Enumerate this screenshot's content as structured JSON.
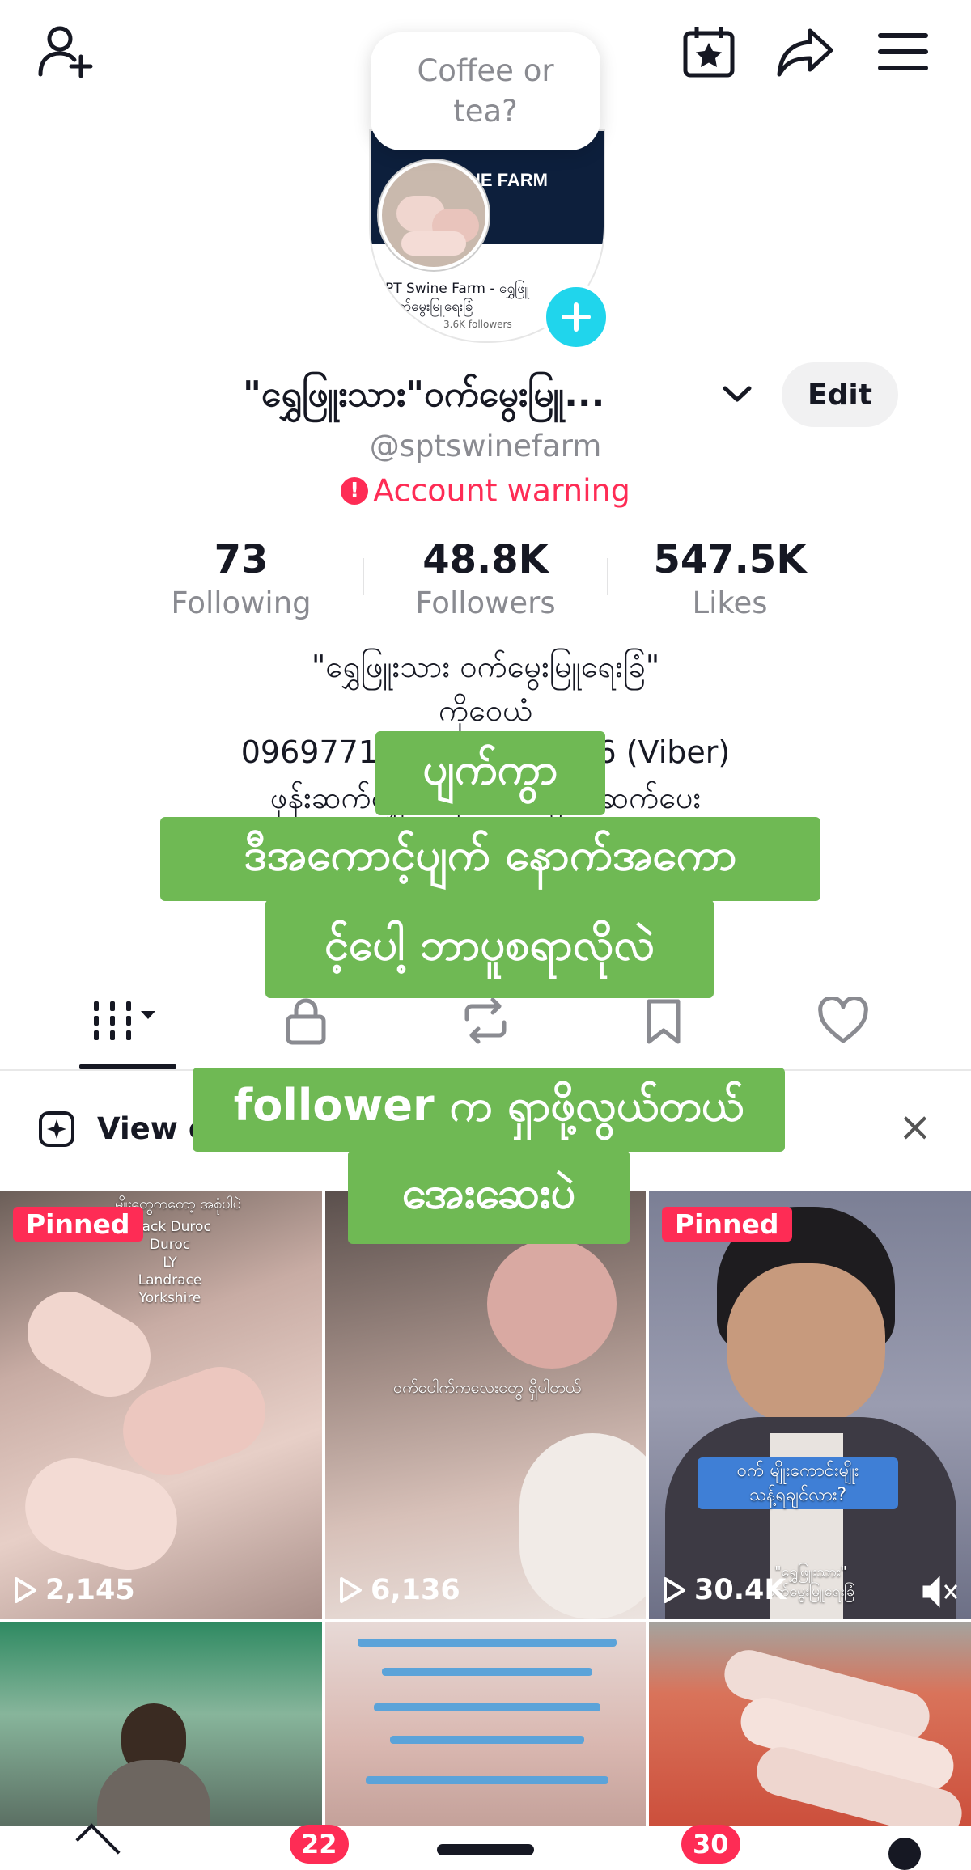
{
  "header": {
    "add_friend_icon": "person-plus-icon",
    "calendar_icon": "calendar-star-icon",
    "share_icon": "share-arrow-icon",
    "menu_icon": "hamburger-menu-icon",
    "tooltip": "Coffee or\ntea?"
  },
  "avatar": {
    "banner_text": "NE FARM",
    "card_name": "PT Swine Farm - ရွှေဖြူ",
    "card_sub": "ဝက်မွေးမြူရေးခြံ",
    "card_followers": "3.6K followers"
  },
  "profile": {
    "name": "\"ရွှေဖြူးသား\"ဝက်မွေးမြူ...",
    "edit_label": "Edit",
    "handle": "@sptswinefarm",
    "warning": "Account warning"
  },
  "stats": [
    {
      "value": "73",
      "label": "Following"
    },
    {
      "value": "48.8K",
      "label": "Followers"
    },
    {
      "value": "547.5K",
      "label": "Likes"
    }
  ],
  "bio": {
    "line1": "\"ရွှေဖြူးသား ဝက်မွေးမြူရေးခြံ\"",
    "line2": "ကိုဝေယံ",
    "line3": "09697714433(V          704916 (Viber)",
    "line4": "ဖုန်းဆက်လျှင် မနက်                    အတွင်း  ဆက်ပေး"
  },
  "captions": {
    "c1": "ပျက်ကွာ",
    "c2": "ဒီအကောင့်ပျက် နောက်အကော",
    "c3": "င့်ပေါ့ ဘာပူစရာလိုလဲ",
    "c4": "follower က ရှာဖို့လွယ်တယ်",
    "c5": "အေးဆေးပဲ"
  },
  "banner": {
    "label": "View e",
    "close": "×"
  },
  "videos": [
    {
      "pinned": "Pinned",
      "views": "2,145",
      "text": "Black Duroc\nDuroc\nLY\nLandrace\nYorkshire",
      "top_text": "မျိုးတွေကတော့ အစုံပါပဲ"
    },
    {
      "pinned": "",
      "views": "6,136",
      "text": "ဝက်ပေါက်ကလေးတွေ ရှိပါတယ်"
    },
    {
      "pinned": "Pinned",
      "views": "30.4K",
      "text": "ဝက် မျိုးကောင်းမျိုး\nသန့်ရချင်လား?",
      "bottom_text": "\"ရွှေဖြူးသား\"\nဝက်မွေးမြူရေးခြံ"
    }
  ],
  "nav": {
    "inbox_badge": "22",
    "messages_badge": "30"
  },
  "colors": {
    "accent_red": "#fe2c55",
    "caption_green": "#6fb954",
    "muted_text": "#8a8b91",
    "plus_blue": "#20d5ec"
  }
}
